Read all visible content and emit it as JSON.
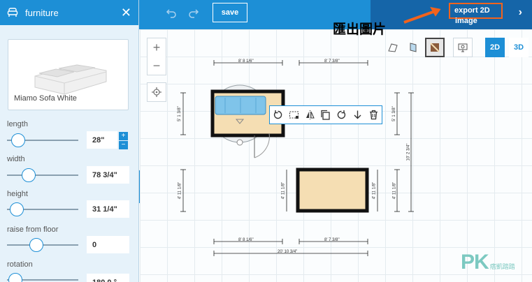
{
  "panel": {
    "title": "furniture",
    "close_glyph": "✕",
    "header_icon": "armchair-icon",
    "item_name": "Miamo Sofa White",
    "props": [
      {
        "label": "length",
        "value": "28\"",
        "level": 0.12
      },
      {
        "label": "width",
        "value": "78 3/4\"",
        "level": 0.27
      },
      {
        "label": "height",
        "value": "31 1/4\"",
        "level": 0.1
      },
      {
        "label": "raise from floor",
        "value": "0",
        "level": 0.38
      },
      {
        "label": "rotation",
        "value": "180.0 °",
        "level": 0.08
      }
    ],
    "stepper": {
      "plus": "+",
      "minus": "−"
    },
    "collapse_glyph": "‹"
  },
  "toolbar": {
    "undo_icon": "undo-icon",
    "redo_icon": "redo-icon",
    "save_label": "save"
  },
  "export": {
    "label": "export 2D",
    "sub": "image",
    "chevron": "›"
  },
  "annotation": "匯出圖片",
  "canvas": {
    "zoom_in": "+",
    "zoom_out": "−",
    "mode_2d": "2D",
    "mode_3d": "3D",
    "dimensions": {
      "top_left": "8' 8 1/6\"",
      "top_right": "8' 7 3/8\"",
      "left_upper": "5' 1 3/8\"",
      "right_upper": "5' 1 3/8\"",
      "right_total": "10' 2 3/4\"",
      "left_lower": "4' 11 1/8\"",
      "mid_left": "4' 11 1/8\"",
      "mid_right": "4' 11 1/8\"",
      "right_lower": "4' 11 1/8\"",
      "bottom_left": "8' 8 1/6\"",
      "bottom_right": "8' 7 3/8\"",
      "bottom_total": "20' 10 3/4\""
    }
  },
  "action_bar": {
    "icons": [
      "rotate-left-icon",
      "select-icon",
      "flip-icon",
      "copy-icon",
      "rotate-right-icon",
      "move-down-icon",
      "trash-icon"
    ]
  },
  "watermark": {
    "logo": "PK",
    "tag": "痞凱踏踏"
  },
  "colors": {
    "accent": "#1d8fd6",
    "export_bg": "#1565a8",
    "highlight": "#f2631d",
    "panel_bg": "#e6f2fa",
    "floor": "#f5deb3",
    "sofa": "#7fc4ea"
  }
}
